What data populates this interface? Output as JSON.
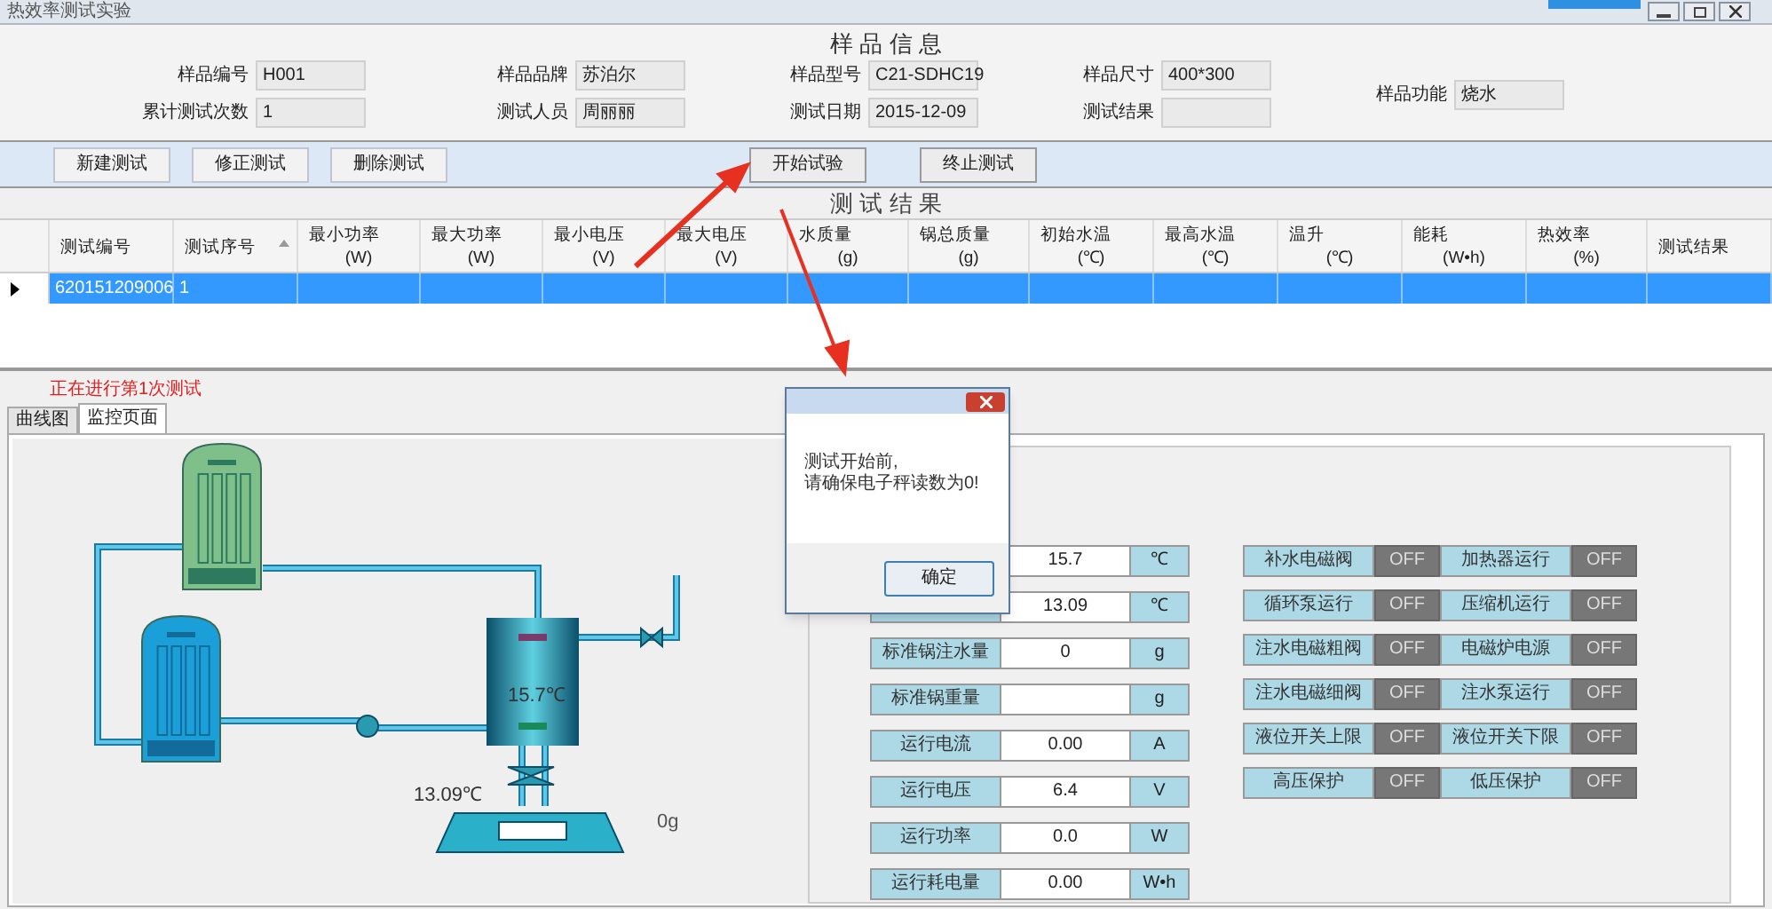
{
  "window": {
    "title": "热效率测试实验"
  },
  "sample_info": {
    "title": "样 品 信 息",
    "columns": [
      [
        {
          "label": "样品编号",
          "value": "H001"
        },
        {
          "label": "累计测试次数",
          "value": "1"
        }
      ],
      [
        {
          "label": "样品品牌",
          "value": "苏泊尔"
        },
        {
          "label": "测试人员",
          "value": "周丽丽"
        }
      ],
      [
        {
          "label": "样品型号",
          "value": "C21-SDHC19"
        },
        {
          "label": "测试日期",
          "value": "2015-12-09"
        }
      ],
      [
        {
          "label": "样品尺寸",
          "value": "400*300"
        },
        {
          "label": "测试结果"
        }
      ],
      [
        {
          "label": "样品功能",
          "value": "烧水"
        }
      ]
    ]
  },
  "toolbar": {
    "left_buttons": [
      "新建测试",
      "修正测试",
      "删除测试"
    ],
    "center_buttons": [
      "开始试验",
      "终止测试"
    ]
  },
  "results": {
    "title": "测 试 结 果",
    "columns": [
      {
        "title": "测试编号"
      },
      {
        "title": "测试序号",
        "sorted": true
      },
      {
        "title": "最小功率",
        "unit": "(W)"
      },
      {
        "title": "最大功率",
        "unit": "(W)"
      },
      {
        "title": "最小电压",
        "unit": "(V)"
      },
      {
        "title": "最大电压",
        "unit": "(V)"
      },
      {
        "title": "水质量",
        "unit": "(g)"
      },
      {
        "title": "锅总质量",
        "unit": "(g)"
      },
      {
        "title": "初始水温",
        "unit": "(℃)"
      },
      {
        "title": "最高水温",
        "unit": "(℃)"
      },
      {
        "title": "温升",
        "unit": "(℃)"
      },
      {
        "title": "能耗",
        "unit": "(W•h)"
      },
      {
        "title": "热效率",
        "unit": "(%)"
      },
      {
        "title": "测试结果"
      }
    ],
    "rows": [
      {
        "selected": true,
        "cells": [
          "620151209006",
          "1"
        ]
      }
    ]
  },
  "status": "正在进行第1次测试",
  "tabs": [
    {
      "label": "曲线图",
      "selected": false
    },
    {
      "label": "监控页面",
      "selected": true
    }
  ],
  "diagram": {
    "heater_temp": "15.7℃",
    "water_temp": "13.09℃",
    "scale_reading": "0g"
  },
  "readings": [
    {
      "value": "15.7",
      "unit": "℃"
    },
    {
      "value": "13.09",
      "unit": "℃"
    },
    {
      "label": "标准锅注水量",
      "value": "0",
      "unit": "g"
    },
    {
      "label": "标准锅重量",
      "unit": "g"
    },
    {
      "label": "运行电流",
      "value": "0.00",
      "unit": "A"
    },
    {
      "label": "运行电压",
      "value": "6.4",
      "unit": "V"
    },
    {
      "label": "运行功率",
      "value": "0.0",
      "unit": "W"
    },
    {
      "label": "运行耗电量",
      "value": "0.00",
      "unit": "W•h"
    }
  ],
  "switches": [
    [
      {
        "label": "补水电磁阀",
        "state": "OFF"
      },
      {
        "label": "加热器运行",
        "state": "OFF"
      }
    ],
    [
      {
        "label": "循环泵运行",
        "state": "OFF"
      },
      {
        "label": "压缩机运行",
        "state": "OFF"
      }
    ],
    [
      {
        "label": "注水电磁粗阀",
        "state": "OFF"
      },
      {
        "label": "电磁炉电源",
        "state": "OFF"
      }
    ],
    [
      {
        "label": "注水电磁细阀",
        "state": "OFF"
      },
      {
        "label": "注水泵运行",
        "state": "OFF"
      }
    ],
    [
      {
        "label": "液位开关上限",
        "state": "OFF"
      },
      {
        "label": "液位开关下限",
        "state": "OFF"
      }
    ],
    [
      {
        "label": "高压保护",
        "state": "OFF"
      },
      {
        "label": "低压保护",
        "state": "OFF"
      }
    ]
  ],
  "dialog": {
    "message_lines": [
      "测试开始前,",
      "请确保电子秤读数为0!"
    ],
    "button": "确定"
  }
}
